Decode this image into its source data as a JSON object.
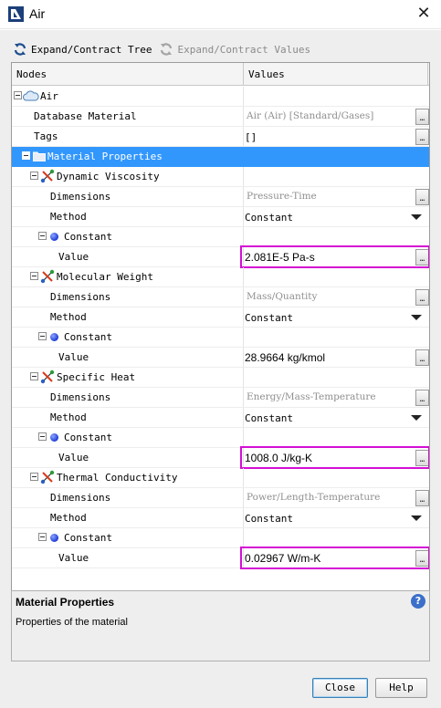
{
  "window": {
    "title": "Air"
  },
  "toolbar": {
    "expand_tree": "Expand/Contract Tree",
    "expand_values": "Expand/Contract Values"
  },
  "table": {
    "col_nodes": "Nodes",
    "col_values": "Values",
    "root": "Air",
    "rows": {
      "database_material": {
        "label": "Database Material",
        "value": "Air (Air) [Standard/Gases]"
      },
      "tags": {
        "label": "Tags",
        "value": "[]"
      },
      "material_properties": {
        "label": "Material Properties"
      },
      "dynamic_viscosity": {
        "label": "Dynamic Viscosity",
        "dimensions": "Pressure-Time",
        "method": "Constant",
        "value": "2.081E-5 Pa-s"
      },
      "molecular_weight": {
        "label": "Molecular Weight",
        "dimensions": "Mass/Quantity",
        "method": "Constant",
        "value": "28.9664 kg/kmol"
      },
      "specific_heat": {
        "label": "Specific Heat",
        "dimensions": "Energy/Mass-Temperature",
        "method": "Constant",
        "value": "1008.0 J/kg-K"
      },
      "thermal_conductivity": {
        "label": "Thermal Conductivity",
        "dimensions": "Power/Length-Temperature",
        "method": "Constant",
        "value": "0.02967 W/m-K"
      }
    },
    "labels": {
      "dimensions": "Dimensions",
      "method": "Method",
      "constant": "Constant",
      "value": "Value"
    }
  },
  "description": {
    "title": "Material Properties",
    "text": "Properties of the material"
  },
  "buttons": {
    "close": "Close",
    "help": "Help"
  },
  "colors": {
    "selection": "#3297fd",
    "highlight_box": "#d40fd4"
  }
}
